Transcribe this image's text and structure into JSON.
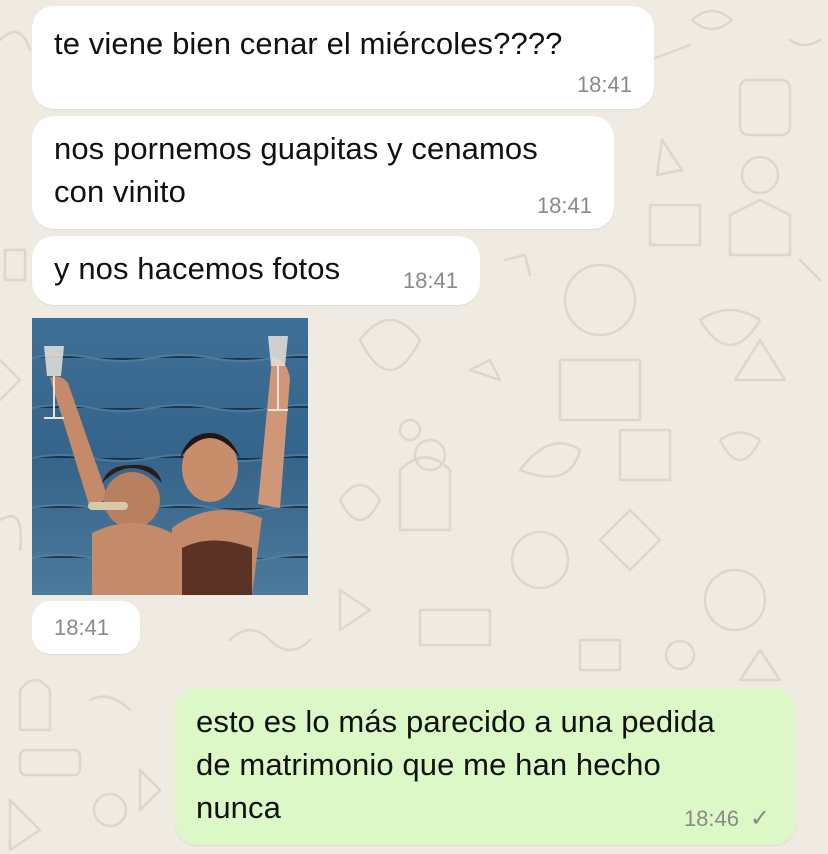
{
  "colors": {
    "background": "#efeae2",
    "incoming_bubble": "#ffffff",
    "outgoing_bubble": "#dcf8c6",
    "timestamp": "#8a8a8a"
  },
  "messages": [
    {
      "text": "te viene bien cenar el miércoles????",
      "time": "18:41",
      "direction": "incoming"
    },
    {
      "text": "nos pornemos guapitas y cenamos\ncon vinito",
      "time": "18:41",
      "direction": "incoming"
    },
    {
      "text": "y nos hacemos fotos",
      "time": "18:41",
      "direction": "incoming"
    },
    {
      "type": "image",
      "time": "18:41",
      "direction": "incoming"
    },
    {
      "text": "esto es lo más parecido a una pedida\nde matrimonio que me han hecho\nnunca",
      "time": "18:46",
      "direction": "outgoing",
      "status_icon": "check-icon"
    }
  ]
}
